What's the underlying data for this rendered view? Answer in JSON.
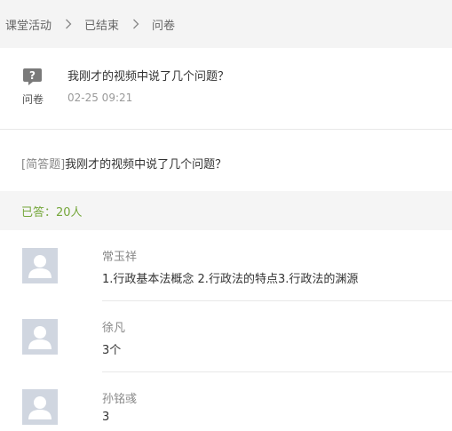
{
  "breadcrumb": {
    "items": [
      "课堂活动",
      "已结束",
      "问卷"
    ]
  },
  "activity": {
    "type_label": "问卷",
    "title": "我刚才的视频中说了几个问题？",
    "time": "02-25 09:21"
  },
  "question": {
    "tag": "[简答题]",
    "text": "我刚才的视频中说了几个问题？"
  },
  "answered": {
    "label": "已答：20人"
  },
  "answers": [
    {
      "name": "常玉祥",
      "text": "1.行政基本法概念 2.行政法的特点3.行政法的渊源"
    },
    {
      "name": "徐凡",
      "text": "3个"
    },
    {
      "name": "孙铭彧",
      "text": "3"
    }
  ],
  "colors": {
    "answered_green": "#76a73c",
    "breadcrumb_bg": "#f4f4f4",
    "avatar_bg": "#d0d6e0"
  }
}
